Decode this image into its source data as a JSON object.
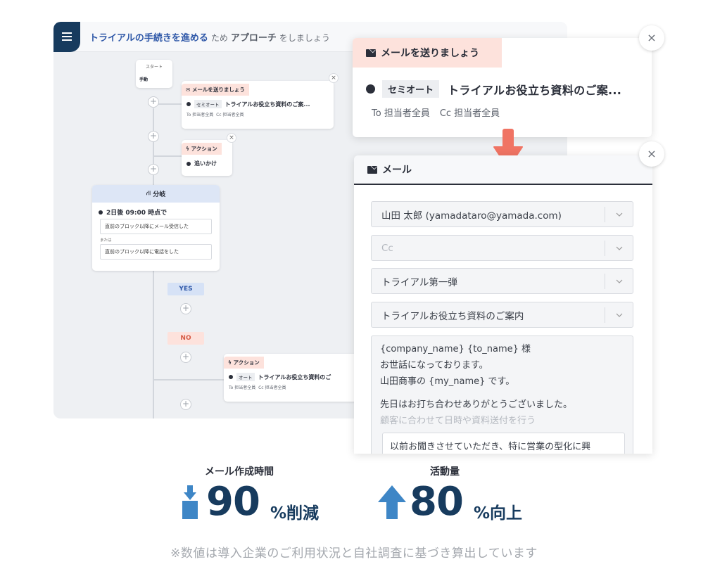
{
  "header": {
    "highlight": "トライアルの手続きを進める",
    "connector": "ため",
    "keyword": "アプローチ",
    "suffix": "をしましょう"
  },
  "flow": {
    "start_title": "スタート",
    "start_mode": "手動",
    "mail_card": {
      "tag": "メールを送りましょう",
      "chip": "セミオート",
      "subject": "トライアルお役立ち資料のご案...",
      "to": "To 担当者全員",
      "cc": "Cc 担当者全員"
    },
    "action_card": {
      "tag": "アクション",
      "item": "追いかけ"
    },
    "branch": {
      "title": "分岐",
      "condition": "2日後 09:00 時点で",
      "option1": "直前のブロック以降にメール受信した",
      "or_label": "または",
      "option2": "直前のブロック以降に電話をした",
      "yes": "YES",
      "no": "NO"
    },
    "action_card2": {
      "tag": "アクション",
      "chip": "オート",
      "subject": "トライアルお役立ち資料のご",
      "to": "To 担当者全員",
      "cc": "Cc 担当者全員"
    }
  },
  "popup_mail_card": {
    "tag": "メールを送りましょう",
    "chip": "セミオート",
    "subject": "トライアルお役立ち資料のご案...",
    "to": "To 担当者全員",
    "cc": "Cc 担当者全員"
  },
  "mail_form": {
    "title": "メール",
    "from": "山田 太郎 (yamadataro@yamada.com)",
    "cc_placeholder": "Cc",
    "template_group": "トライアル第一弾",
    "template": "トライアルお役立ち資料のご案内",
    "body_line1": "{company_name} {to_name} 様",
    "body_line2": "お世話になっております。",
    "body_line3": "山田商事の {my_name} です。",
    "body_line4": "先日はお打ち合わせありがとうございました。",
    "body_hint": "顧客に合わせて日時や資料送付を行う",
    "body_inner": "以前お聞きさせていただき、特に営業の型化に興"
  },
  "stats": [
    {
      "label": "メール作成時間",
      "value": "90",
      "unit": "%削減",
      "direction": "down"
    },
    {
      "label": "活動量",
      "value": "80",
      "unit": "%向上",
      "direction": "up"
    }
  ],
  "footnote": "※数値は導入企業のご利用状況と自社調査に基づき算出しています",
  "colors": {
    "navy": "#173b5e",
    "accent_blue": "#3e86c6",
    "salmon": "#fde2dc",
    "arrow": "#f07464"
  },
  "icons": {
    "close": "×",
    "plus": "+",
    "lightning": "ϟ",
    "branch": "⛙"
  }
}
